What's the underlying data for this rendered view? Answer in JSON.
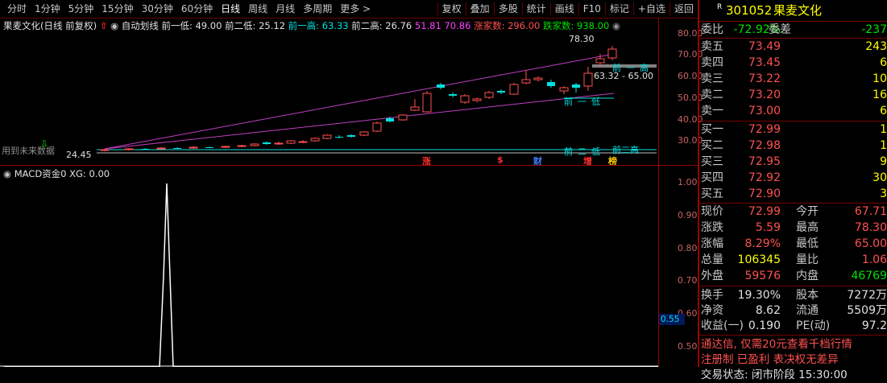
{
  "toolbar": {
    "periods": [
      "分时",
      "1分钟",
      "5分钟",
      "15分钟",
      "30分钟",
      "60分钟",
      "日线",
      "周线",
      "月线",
      "多周期",
      "更多 >"
    ],
    "active_period": "日线",
    "actions": [
      "复权",
      "叠加",
      "多股",
      "统计",
      "画线",
      "F10",
      "标记",
      "+自选",
      "返回"
    ]
  },
  "chart_header": {
    "name": "果麦文化(日线 前复权)",
    "indicator": "自动划线",
    "qian_yi_di": "前一低: 49.00",
    "qian_er_di": "前二低: 25.12",
    "qian_yi_gao": "前一高: 63.33",
    "qian_er_gao": "前二高: 26.76",
    "v1": "51.81",
    "v2": "70.86",
    "zhang_jia_shu": "涨家数: 296.00",
    "die_jia_shu": "跌家数: 938.00"
  },
  "chart_annotations": {
    "high_label": "78.30",
    "low_label": "24.45",
    "range_label": "63.32 - 65.00",
    "qian_gao": "前一高",
    "qian_di": "前一低",
    "qian_er_di": "前二低",
    "qian_er_gao": "前二高",
    "future_label": "用到未来数据",
    "markers": [
      "涨",
      "$",
      "财",
      "增",
      "榜"
    ]
  },
  "upper_axis": [
    "80.00",
    "70.00",
    "60.00",
    "50.00",
    "40.00",
    "30.00"
  ],
  "macd_header": "MACD资金0 XG: 0.00",
  "lower_axis": [
    "1.00",
    "0.90",
    "0.80",
    "0.70",
    "0.60",
    "0.50"
  ],
  "lower_badge": "0.55",
  "stock": {
    "code": "301052",
    "name": "果麦文化",
    "badge": "R"
  },
  "order_book": {
    "wei_bi_label": "委比",
    "wei_bi": "-72.92%",
    "wei_cha_label": "委差",
    "wei_cha": "-237",
    "sells": [
      {
        "label": "卖五",
        "price": "73.49",
        "vol": "243"
      },
      {
        "label": "卖四",
        "price": "73.45",
        "vol": "6"
      },
      {
        "label": "卖三",
        "price": "73.22",
        "vol": "10"
      },
      {
        "label": "卖二",
        "price": "73.20",
        "vol": "16"
      },
      {
        "label": "卖一",
        "price": "73.00",
        "vol": "6"
      }
    ],
    "buys": [
      {
        "label": "买一",
        "price": "72.99",
        "vol": "1"
      },
      {
        "label": "买二",
        "price": "72.98",
        "vol": "1"
      },
      {
        "label": "买三",
        "price": "72.95",
        "vol": "9"
      },
      {
        "label": "买四",
        "price": "72.92",
        "vol": "30"
      },
      {
        "label": "买五",
        "price": "72.90",
        "vol": "3"
      }
    ]
  },
  "quote": [
    {
      "l1": "现价",
      "v1": "72.99",
      "c1": "red",
      "l2": "今开",
      "v2": "67.71",
      "c2": "red"
    },
    {
      "l1": "涨跌",
      "v1": "5.59",
      "c1": "red",
      "l2": "最高",
      "v2": "78.30",
      "c2": "red"
    },
    {
      "l1": "涨幅",
      "v1": "8.29%",
      "c1": "red",
      "l2": "最低",
      "v2": "65.00",
      "c2": "red"
    },
    {
      "l1": "总量",
      "v1": "106345",
      "c1": "yellow",
      "l2": "量比",
      "v2": "1.06",
      "c2": "red"
    },
    {
      "l1": "外盘",
      "v1": "59576",
      "c1": "red",
      "l2": "内盘",
      "v2": "46769",
      "c2": "green"
    }
  ],
  "fundamentals": [
    {
      "l1": "换手",
      "v1": "19.30%",
      "l2": "股本",
      "v2": "7272万"
    },
    {
      "l1": "净资",
      "v1": "8.62",
      "l2": "流通",
      "v2": "5509万"
    },
    {
      "l1": "收益(一)",
      "v1": "0.190",
      "l2": "PE(动)",
      "v2": "97.2"
    }
  ],
  "notices": [
    "通达信, 仅需20元查看千档行情",
    "注册制 已盈利 表决权无差异",
    "交易状态: 闭市阶段 15:30:00"
  ]
}
